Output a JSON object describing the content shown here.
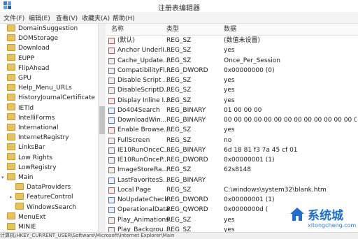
{
  "window": {
    "title": "注册表编辑器"
  },
  "menu": [
    "文件(F)",
    "编辑(E)",
    "查看(V)",
    "收藏夹(A)",
    "帮助(H)"
  ],
  "tree": [
    {
      "label": "DomainSuggestion",
      "indent": 0,
      "expander": ""
    },
    {
      "label": "DOMStorage",
      "indent": 0,
      "expander": ""
    },
    {
      "label": "Download",
      "indent": 0,
      "expander": ""
    },
    {
      "label": "EUPP",
      "indent": 0,
      "expander": ""
    },
    {
      "label": "FlipAhead",
      "indent": 0,
      "expander": ""
    },
    {
      "label": "GPU",
      "indent": 0,
      "expander": ""
    },
    {
      "label": "Help_Menu_URLs",
      "indent": 0,
      "expander": ""
    },
    {
      "label": "HistoryJournalCertificate",
      "indent": 0,
      "expander": ""
    },
    {
      "label": "IETld",
      "indent": 0,
      "expander": ""
    },
    {
      "label": "IntelliForms",
      "indent": 0,
      "expander": ""
    },
    {
      "label": "International",
      "indent": 0,
      "expander": ""
    },
    {
      "label": "InternetRegistry",
      "indent": 0,
      "expander": ""
    },
    {
      "label": "LinksBar",
      "indent": 0,
      "expander": ""
    },
    {
      "label": "Low Rights",
      "indent": 0,
      "expander": ""
    },
    {
      "label": "LowRegistry",
      "indent": 0,
      "expander": ""
    },
    {
      "label": "Main",
      "indent": 0,
      "expander": "▾"
    },
    {
      "label": "DataProviders",
      "indent": 1,
      "expander": ""
    },
    {
      "label": "FeatureControl",
      "indent": 1,
      "expander": "▸"
    },
    {
      "label": "WindowsSearch",
      "indent": 1,
      "expander": ""
    },
    {
      "label": "MenuExt",
      "indent": 0,
      "expander": ""
    },
    {
      "label": "MINIE",
      "indent": 0,
      "expander": ""
    }
  ],
  "columns": {
    "name": "名称",
    "type": "类型",
    "data": "数据"
  },
  "values": [
    {
      "name": "(默认)",
      "type": "REG_SZ",
      "data": "(数值未设置)",
      "icon": "string-value-icon"
    },
    {
      "name": "Anchor Underli...",
      "type": "REG_SZ",
      "data": "yes",
      "icon": "string-value-icon"
    },
    {
      "name": "Cache_Update...",
      "type": "REG_SZ",
      "data": "Once_Per_Session",
      "icon": "string-value-icon"
    },
    {
      "name": "CompatibilityFl...",
      "type": "REG_DWORD",
      "data": "0x00000000 (0)",
      "icon": "binary-value-icon"
    },
    {
      "name": "Disable Script ...",
      "type": "REG_SZ",
      "data": "yes",
      "icon": "string-value-icon"
    },
    {
      "name": "DisableScriptD...",
      "type": "REG_SZ",
      "data": "yes",
      "icon": "string-value-icon"
    },
    {
      "name": "Display Inline I...",
      "type": "REG_SZ",
      "data": "yes",
      "icon": "string-value-icon"
    },
    {
      "name": "Do404Search",
      "type": "REG_BINARY",
      "data": "01 00 00 00",
      "icon": "binary-value-icon"
    },
    {
      "name": "DownloadWin...",
      "type": "REG_BINARY",
      "data": "00 00 00 00 00 00 00 00 00 00 00 00 00 00 00 00 00 00",
      "icon": "binary-value-icon"
    },
    {
      "name": "Enable Browse...",
      "type": "REG_SZ",
      "data": "yes",
      "icon": "string-value-icon"
    },
    {
      "name": "FullScreen",
      "type": "REG_SZ",
      "data": "no",
      "icon": "string-value-icon"
    },
    {
      "name": "IE10RunOnceC...",
      "type": "REG_BINARY",
      "data": "6d 18 81 f3 7a 45 cf 01",
      "icon": "binary-value-icon"
    },
    {
      "name": "IE10RunOnceP...",
      "type": "REG_DWORD",
      "data": "0x00000001 (1)",
      "icon": "binary-value-icon"
    },
    {
      "name": "ImageStoreRa...",
      "type": "REG_SZ",
      "data": "62s8148",
      "icon": "string-value-icon"
    },
    {
      "name": "LastFavoritesS...",
      "type": "REG_BINARY",
      "data": "",
      "icon": "binary-value-icon"
    },
    {
      "name": "Local Page",
      "type": "REG_SZ",
      "data": "C:\\windows\\system32\\blank.htm",
      "icon": "string-value-icon"
    },
    {
      "name": "NoUpdateCheck",
      "type": "REG_DWORD",
      "data": "0x00000001 (1)",
      "icon": "binary-value-icon"
    },
    {
      "name": "OperationalData",
      "type": "REG_QWORD",
      "data": "0x0000000d (",
      "icon": "binary-value-icon"
    },
    {
      "name": "Play_Animations",
      "type": "REG_SZ",
      "data": "yes",
      "icon": "string-value-icon"
    },
    {
      "name": "Play_Backgrou...",
      "type": "REG_SZ",
      "data": "yes",
      "icon": "string-value-icon"
    }
  ],
  "statusbar": {
    "path": "计算机\\HKEY_CURRENT_USER\\Software\\Microsoft\\Internet Explorer\\Main"
  },
  "watermark": {
    "brand": "系统城",
    "site": "xitongcheng.com"
  }
}
